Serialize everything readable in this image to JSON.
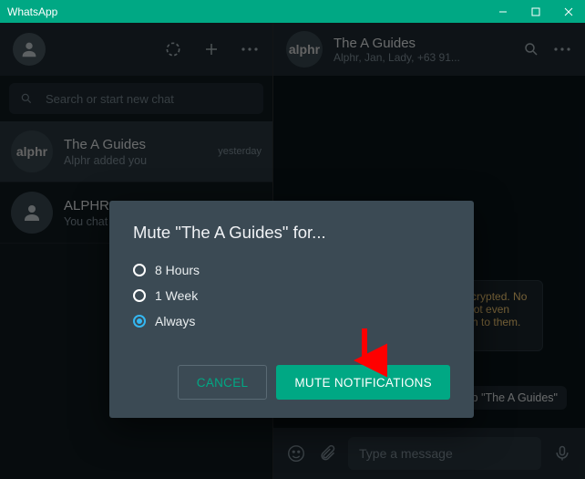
{
  "window": {
    "title": "WhatsApp"
  },
  "sidebar": {
    "search_placeholder": "Search or start new chat",
    "chats": [
      {
        "title": "The A Guides",
        "subtitle": "Alphr added you",
        "time": "yesterday",
        "avatar": "alphr"
      },
      {
        "title": "ALPHR",
        "subtitle": "You chat",
        "time": "",
        "avatar": ""
      }
    ]
  },
  "main": {
    "title": "The A Guides",
    "subtitle": "Alphr, Jan, Lady, +63 91...",
    "encryption_notice": "Messages are end-to-end encrypted. No one outside of this chat, not even WhatsApp, can read or listen to them. Tap to learn more.",
    "bubble": "You created group \"The A Guides\"",
    "compose_placeholder": "Type a message"
  },
  "modal": {
    "title": "Mute \"The A Guides\" for...",
    "options": [
      "8 Hours",
      "1 Week",
      "Always"
    ],
    "selected_index": 2,
    "cancel_label": "Cancel",
    "confirm_label": "Mute Notifications"
  }
}
